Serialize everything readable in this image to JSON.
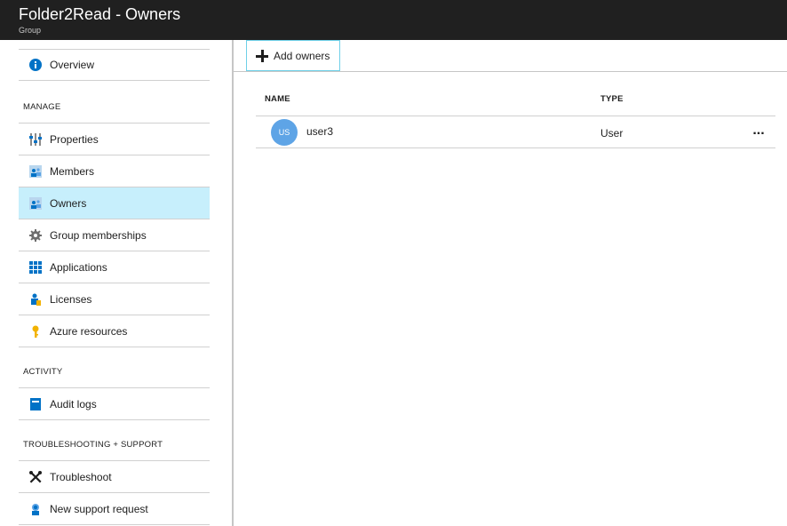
{
  "header": {
    "title": "Folder2Read - Owners",
    "subtitle": "Group"
  },
  "sidebar": {
    "overview": {
      "label": "Overview",
      "icon": "info-icon"
    },
    "manage_header": "MANAGE",
    "manage_items": [
      {
        "label": "Properties",
        "icon": "properties-icon"
      },
      {
        "label": "Members",
        "icon": "members-icon"
      },
      {
        "label": "Owners",
        "icon": "owners-icon",
        "selected": true
      },
      {
        "label": "Group memberships",
        "icon": "gear-icon"
      },
      {
        "label": "Applications",
        "icon": "applications-grid-icon"
      },
      {
        "label": "Licenses",
        "icon": "licenses-icon"
      },
      {
        "label": "Azure resources",
        "icon": "key-icon"
      }
    ],
    "activity_header": "ACTIVITY",
    "activity_items": [
      {
        "label": "Audit logs",
        "icon": "audit-logs-icon"
      }
    ],
    "support_header": "TROUBLESHOOTING + SUPPORT",
    "support_items": [
      {
        "label": "Troubleshoot",
        "icon": "wrench-icon"
      },
      {
        "label": "New support request",
        "icon": "support-person-icon"
      }
    ]
  },
  "toolbar": {
    "add_owners_label": "Add owners"
  },
  "grid": {
    "columns": {
      "name": "NAME",
      "type": "TYPE"
    },
    "rows": [
      {
        "initials": "US",
        "name": "user3",
        "type": "User",
        "more": "..."
      }
    ]
  },
  "colors": {
    "titlebar": "#202020",
    "selected_nav": "#c7effc",
    "accent_border": "#6fd0e8",
    "avatar": "#5ea4e6",
    "icon_blue": "#0072c6"
  }
}
